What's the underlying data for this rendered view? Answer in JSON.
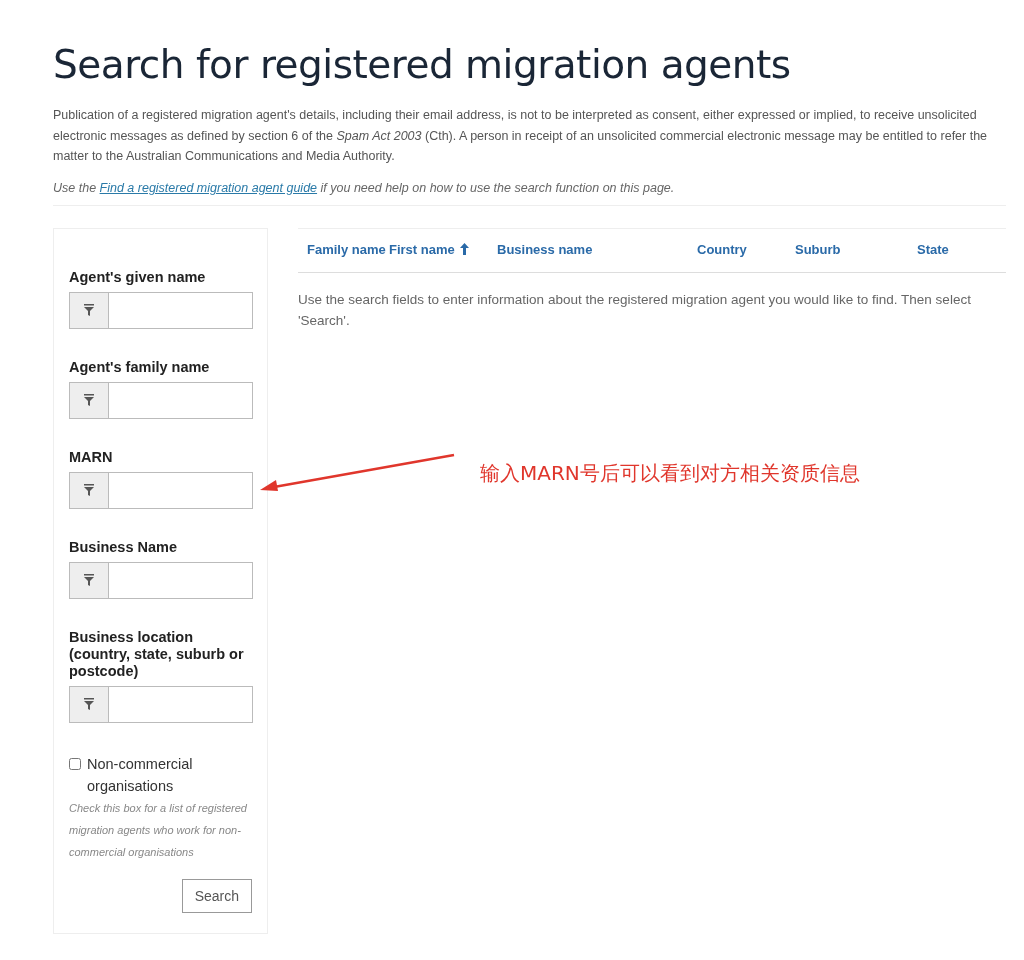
{
  "page": {
    "title": "Search for registered migration agents",
    "notice": "Publication of a registered migration agent's details, including their email address, is not to be interpreted as consent, either expressed or implied, to receive unsolicited electronic messages as defined by section 6 of the *Spam Act 2003* (Cth). A person in receipt of an unsolicited commercial electronic message may be entitled to refer the matter to the Australian Communications and Media Authority.",
    "help_before": "Use the",
    "help_link": "Find a registered migration agent guide",
    "help_after": "if you need help on how to use the search function on this page."
  },
  "filters": {
    "fields": [
      {
        "label": "Agent's given name"
      },
      {
        "label": "Agent's family name"
      },
      {
        "label": "MARN"
      },
      {
        "label": "Business Name"
      },
      {
        "label": "Business location (country, state, suburb or postcode)"
      }
    ],
    "checkbox": {
      "label": "Non-commercial organisations",
      "checked": false,
      "hint": "Check this box for a list of registered migration agents who work for non-commercial organisations"
    },
    "button": "Search"
  },
  "table": {
    "columns": [
      {
        "label": "Family name",
        "sorted": false
      },
      {
        "label": "First name",
        "sorted": true
      },
      {
        "label": "Business name",
        "sorted": false
      },
      {
        "label": "Country",
        "sorted": false
      },
      {
        "label": "Suburb",
        "sorted": false
      },
      {
        "label": "State",
        "sorted": false
      }
    ],
    "message": "Use the search fields to enter information about the registered migration agent you would like to find. Then select 'Search'."
  },
  "annotation": {
    "text": "输入MARN号后可以看到对方相关资质信息"
  }
}
